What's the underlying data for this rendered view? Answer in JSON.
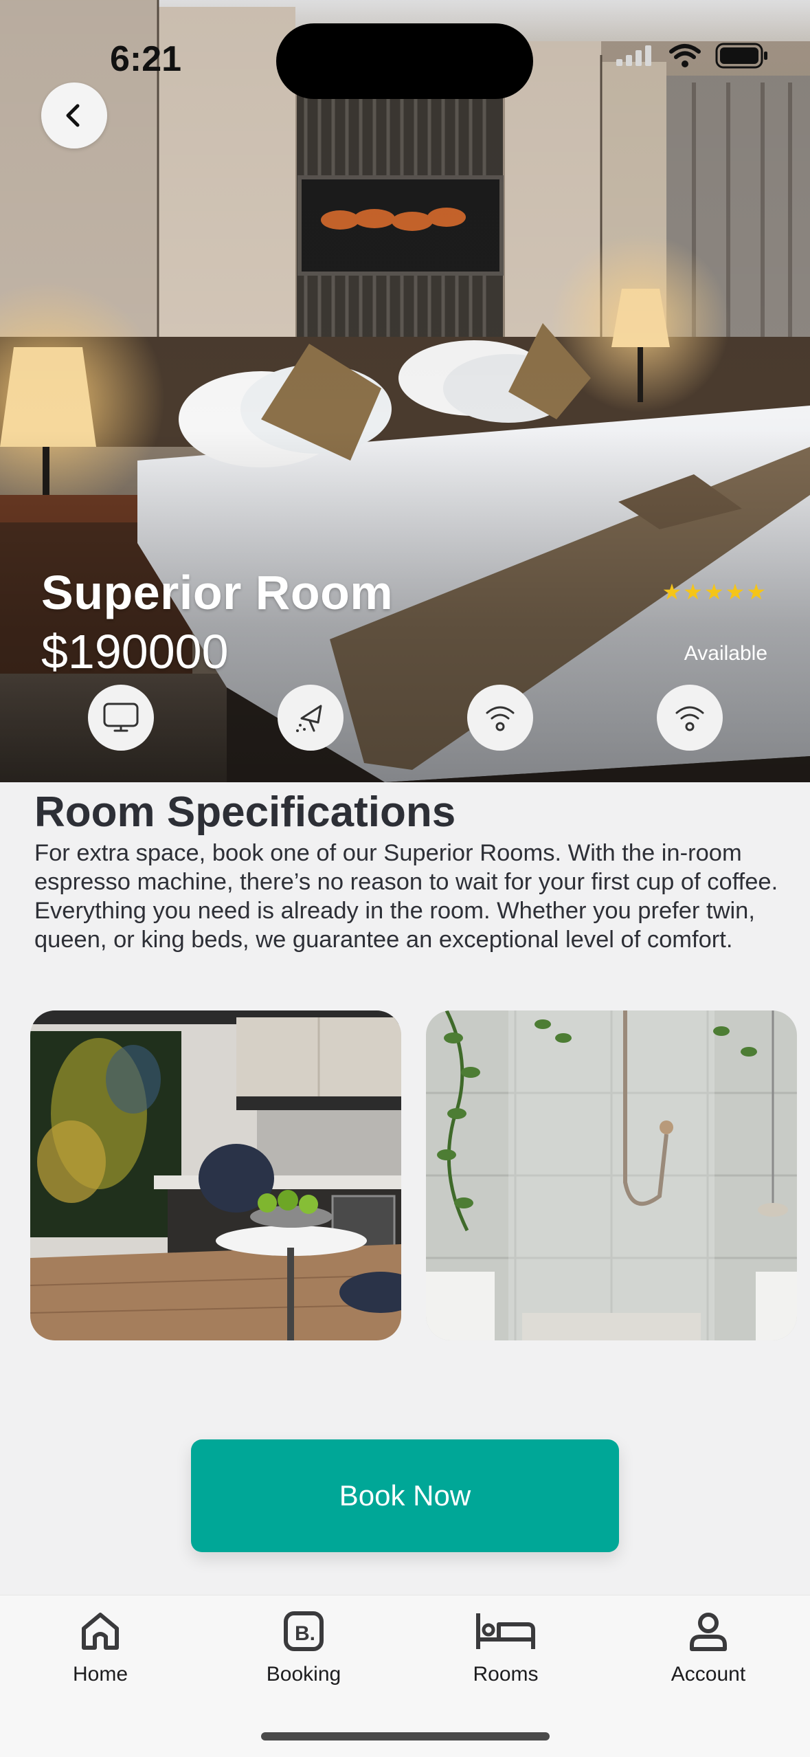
{
  "status_bar": {
    "time": "6:21"
  },
  "hero": {
    "room_name": "Superior Room",
    "price": "$190000",
    "rating_stars": "★★★★★",
    "rating": 5,
    "availability": "Available",
    "amenities": [
      "tv-icon",
      "cleaning-icon",
      "wifi-icon",
      "wifi-icon"
    ]
  },
  "specifications": {
    "title": "Room Specifications",
    "description": "For extra space, book one of our Superior Rooms. With the in-room espresso machine, there’s no reason to wait for your first cup of coffee. Everything you need is already in the room. Whether you prefer twin, queen, or king beds, we guarantee an exceptional level of comfort."
  },
  "cta": {
    "book_label": "Book Now"
  },
  "tabbar": {
    "items": [
      {
        "label": "Home",
        "icon": "home-icon"
      },
      {
        "label": "Booking",
        "icon": "booking-icon"
      },
      {
        "label": "Rooms",
        "icon": "bed-icon"
      },
      {
        "label": "Account",
        "icon": "account-icon"
      }
    ]
  },
  "colors": {
    "accent": "#00a797",
    "star": "#f5c518",
    "text": "#2d2f36"
  }
}
